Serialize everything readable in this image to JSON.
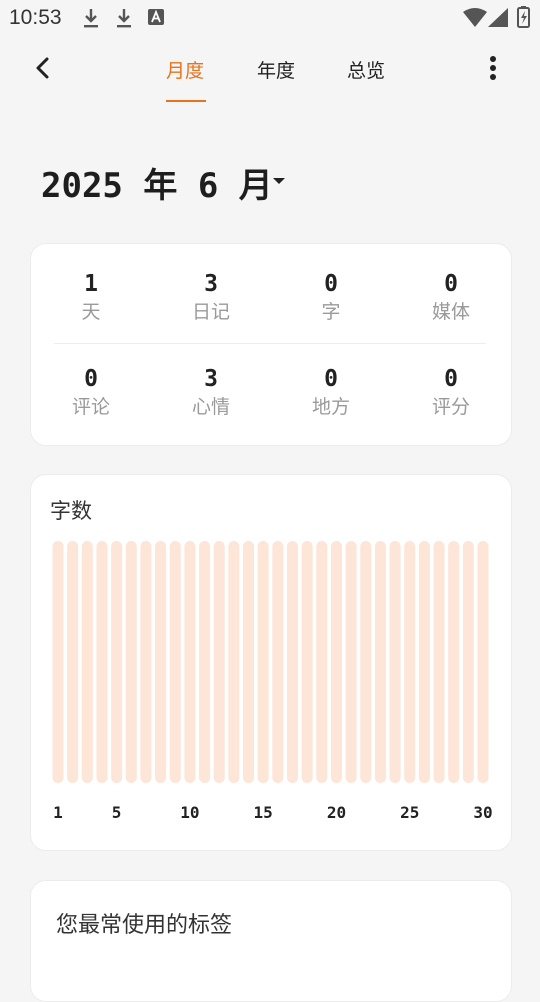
{
  "status_bar": {
    "time": "10:53",
    "left_icons": [
      "download-icon",
      "download-icon",
      "text-a-icon"
    ],
    "right_icons": [
      "wifi-icon",
      "cellular-signal-icon",
      "battery-charging-icon"
    ]
  },
  "header": {
    "back_icon": "chevron-left-icon",
    "tabs": [
      {
        "label": "月度",
        "active": true
      },
      {
        "label": "年度",
        "active": false
      },
      {
        "label": "总览",
        "active": false
      }
    ],
    "more_icon": "more-vertical-icon"
  },
  "period": {
    "label": "2025 年 6 月",
    "dropdown_icon": "caret-down-icon"
  },
  "stats": {
    "row1": [
      {
        "value": "1",
        "label": "天"
      },
      {
        "value": "3",
        "label": "日记"
      },
      {
        "value": "0",
        "label": "字"
      },
      {
        "value": "0",
        "label": "媒体"
      }
    ],
    "row2": [
      {
        "value": "0",
        "label": "评论"
      },
      {
        "value": "3",
        "label": "心情"
      },
      {
        "value": "0",
        "label": "地方"
      },
      {
        "value": "0",
        "label": "评分"
      }
    ]
  },
  "word_count": {
    "title": "字数",
    "chart_data": {
      "type": "bar",
      "categories": [
        1,
        2,
        3,
        4,
        5,
        6,
        7,
        8,
        9,
        10,
        11,
        12,
        13,
        14,
        15,
        16,
        17,
        18,
        19,
        20,
        21,
        22,
        23,
        24,
        25,
        26,
        27,
        28,
        29,
        30
      ],
      "values": [
        0,
        0,
        0,
        0,
        0,
        0,
        0,
        0,
        0,
        0,
        0,
        0,
        0,
        0,
        0,
        0,
        0,
        0,
        0,
        0,
        0,
        0,
        0,
        0,
        0,
        0,
        0,
        0,
        0,
        0
      ],
      "x_tick_labels": [
        "1",
        "5",
        "10",
        "15",
        "20",
        "25",
        "30"
      ],
      "x_tick_days": [
        1,
        5,
        10,
        15,
        20,
        25,
        30
      ],
      "title": "字数",
      "xlabel": "",
      "ylabel": "",
      "grid": false,
      "colors": {
        "track": "#fde5d8",
        "bar": "#e8731f"
      }
    }
  },
  "tags": {
    "title": "您最常使用的标签"
  },
  "colors": {
    "accent": "#e8731f",
    "background": "#f5f5f5",
    "card": "#ffffff"
  }
}
